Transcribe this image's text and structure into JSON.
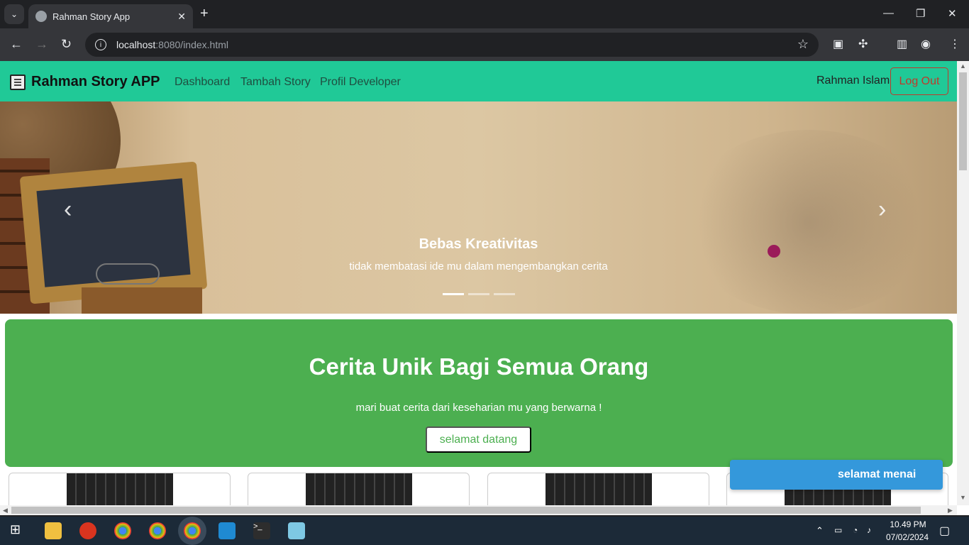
{
  "browser": {
    "tab_title": "Rahman Story App",
    "url_host": "localhost",
    "url_path": ":8080/index.html"
  },
  "navbar": {
    "brand": "Rahman Story APP",
    "links": [
      "Dashboard",
      "Tambah Story",
      "Profil Developer"
    ],
    "user": "Rahman Islam",
    "logout": "Log Out"
  },
  "carousel": {
    "title": "Bebas Kreativitas",
    "text": "tidak membatasi ide mu dalam mengembangkan cerita",
    "active_index": 0,
    "slide_count": 3
  },
  "jumbotron": {
    "heading": "Cerita Unik Bagi Semua Orang",
    "text": "mari buat cerita dari keseharian mu yang berwarna !",
    "button": "selamat datang"
  },
  "toast": "selamat menai",
  "taskbar": {
    "time": "10.49 PM",
    "date": "07/02/2024"
  },
  "colors": {
    "navbar": "#20c997",
    "jumbotron": "#4caf50",
    "toast": "#3498db"
  }
}
